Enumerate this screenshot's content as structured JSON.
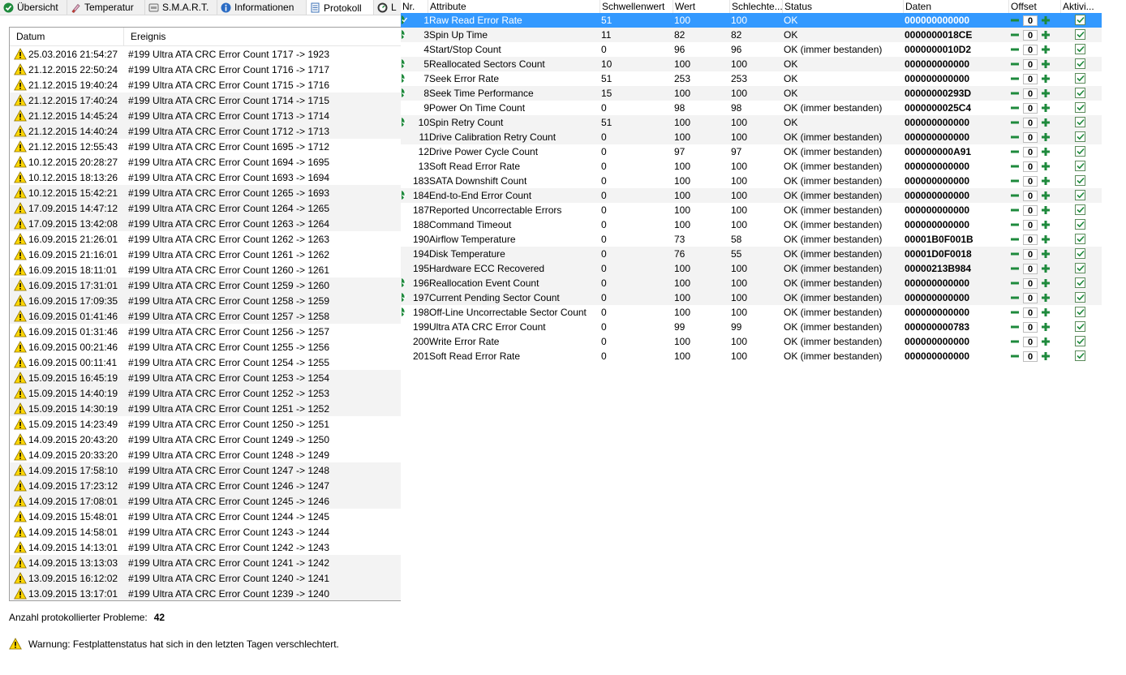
{
  "tabs": [
    {
      "label": "Übersicht",
      "icon": "green-check-icon"
    },
    {
      "label": "Temperatur",
      "icon": "thermometer-icon"
    },
    {
      "label": "S.M.A.R.T.",
      "icon": "smart-icon"
    },
    {
      "label": "Informationen",
      "icon": "info-icon"
    },
    {
      "label": "Protokoll",
      "icon": "document-icon",
      "active": true
    },
    {
      "label": "L",
      "icon": "gauge-icon"
    }
  ],
  "log": {
    "columns": {
      "date": "Datum",
      "event": "Ereignis"
    },
    "rows": [
      {
        "date": "25.03.2016 21:54:27",
        "event": "#199  Ultra ATA CRC Error Count  1717 -> 1923"
      },
      {
        "date": "21.12.2015 22:50:24",
        "event": "#199  Ultra ATA CRC Error Count  1716 -> 1717"
      },
      {
        "date": "21.12.2015 19:40:24",
        "event": "#199  Ultra ATA CRC Error Count  1715 -> 1716"
      },
      {
        "date": "21.12.2015 17:40:24",
        "event": "#199  Ultra ATA CRC Error Count  1714 -> 1715"
      },
      {
        "date": "21.12.2015 14:45:24",
        "event": "#199  Ultra ATA CRC Error Count  1713 -> 1714"
      },
      {
        "date": "21.12.2015 14:40:24",
        "event": "#199  Ultra ATA CRC Error Count  1712 -> 1713"
      },
      {
        "date": "21.12.2015 12:55:43",
        "event": "#199  Ultra ATA CRC Error Count  1695 -> 1712"
      },
      {
        "date": "10.12.2015 20:28:27",
        "event": "#199  Ultra ATA CRC Error Count  1694 -> 1695"
      },
      {
        "date": "10.12.2015 18:13:26",
        "event": "#199  Ultra ATA CRC Error Count  1693 -> 1694"
      },
      {
        "date": "10.12.2015 15:42:21",
        "event": "#199  Ultra ATA CRC Error Count  1265 -> 1693"
      },
      {
        "date": "17.09.2015 14:47:12",
        "event": "#199  Ultra ATA CRC Error Count  1264 -> 1265"
      },
      {
        "date": "17.09.2015 13:42:08",
        "event": "#199  Ultra ATA CRC Error Count  1263 -> 1264"
      },
      {
        "date": "16.09.2015 21:26:01",
        "event": "#199  Ultra ATA CRC Error Count  1262 -> 1263"
      },
      {
        "date": "16.09.2015 21:16:01",
        "event": "#199  Ultra ATA CRC Error Count  1261 -> 1262"
      },
      {
        "date": "16.09.2015 18:11:01",
        "event": "#199  Ultra ATA CRC Error Count  1260 -> 1261"
      },
      {
        "date": "16.09.2015 17:31:01",
        "event": "#199  Ultra ATA CRC Error Count  1259 -> 1260"
      },
      {
        "date": "16.09.2015 17:09:35",
        "event": "#199  Ultra ATA CRC Error Count  1258 -> 1259"
      },
      {
        "date": "16.09.2015 01:41:46",
        "event": "#199  Ultra ATA CRC Error Count  1257 -> 1258"
      },
      {
        "date": "16.09.2015 01:31:46",
        "event": "#199  Ultra ATA CRC Error Count  1256 -> 1257"
      },
      {
        "date": "16.09.2015 00:21:46",
        "event": "#199  Ultra ATA CRC Error Count  1255 -> 1256"
      },
      {
        "date": "16.09.2015 00:11:41",
        "event": "#199  Ultra ATA CRC Error Count  1254 -> 1255"
      },
      {
        "date": "15.09.2015 16:45:19",
        "event": "#199  Ultra ATA CRC Error Count  1253 -> 1254"
      },
      {
        "date": "15.09.2015 14:40:19",
        "event": "#199  Ultra ATA CRC Error Count  1252 -> 1253"
      },
      {
        "date": "15.09.2015 14:30:19",
        "event": "#199  Ultra ATA CRC Error Count  1251 -> 1252"
      },
      {
        "date": "15.09.2015 14:23:49",
        "event": "#199  Ultra ATA CRC Error Count  1250 -> 1251"
      },
      {
        "date": "14.09.2015 20:43:20",
        "event": "#199  Ultra ATA CRC Error Count  1249 -> 1250"
      },
      {
        "date": "14.09.2015 20:33:20",
        "event": "#199  Ultra ATA CRC Error Count  1248 -> 1249"
      },
      {
        "date": "14.09.2015 17:58:10",
        "event": "#199  Ultra ATA CRC Error Count  1247 -> 1248"
      },
      {
        "date": "14.09.2015 17:23:12",
        "event": "#199  Ultra ATA CRC Error Count  1246 -> 1247"
      },
      {
        "date": "14.09.2015 17:08:01",
        "event": "#199  Ultra ATA CRC Error Count  1245 -> 1246"
      },
      {
        "date": "14.09.2015 15:48:01",
        "event": "#199  Ultra ATA CRC Error Count  1244 -> 1245"
      },
      {
        "date": "14.09.2015 14:58:01",
        "event": "#199  Ultra ATA CRC Error Count  1243 -> 1244"
      },
      {
        "date": "14.09.2015 14:13:01",
        "event": "#199  Ultra ATA CRC Error Count  1242 -> 1243"
      },
      {
        "date": "14.09.2015 13:13:03",
        "event": "#199  Ultra ATA CRC Error Count  1241 -> 1242"
      },
      {
        "date": "13.09.2015 16:12:02",
        "event": "#199  Ultra ATA CRC Error Count  1240 -> 1241"
      },
      {
        "date": "13.09.2015 13:17:01",
        "event": "#199  Ultra ATA CRC Error Count  1239 -> 1240"
      }
    ]
  },
  "summary": {
    "label": "Anzahl protokollierter Probleme:",
    "value": "42"
  },
  "warning": {
    "text": "Warnung: Festplattenstatus hat sich in den letzten Tagen verschlechtert."
  },
  "smart": {
    "columns": {
      "nr": "Nr.",
      "attribute": "Attribute",
      "threshold": "Schwellenwert",
      "value": "Wert",
      "worst": "Schlechte...",
      "status": "Status",
      "data": "Daten",
      "offset": "Offset",
      "active": "Aktivi..."
    },
    "rows": [
      {
        "nr": "1",
        "attr": "Raw Read Error Rate",
        "thr": "51",
        "val": "100",
        "worst": "100",
        "status": "OK",
        "data": "000000000000",
        "offset": "0",
        "critical": true,
        "selected": true
      },
      {
        "nr": "3",
        "attr": "Spin Up Time",
        "thr": "11",
        "val": "82",
        "worst": "82",
        "status": "OK",
        "data": "0000000018CE",
        "offset": "0",
        "critical": true
      },
      {
        "nr": "4",
        "attr": "Start/Stop Count",
        "thr": "0",
        "val": "96",
        "worst": "96",
        "status": "OK (immer bestanden)",
        "data": "0000000010D2",
        "offset": "0",
        "critical": false
      },
      {
        "nr": "5",
        "attr": "Reallocated Sectors Count",
        "thr": "10",
        "val": "100",
        "worst": "100",
        "status": "OK",
        "data": "000000000000",
        "offset": "0",
        "critical": true
      },
      {
        "nr": "7",
        "attr": "Seek Error Rate",
        "thr": "51",
        "val": "253",
        "worst": "253",
        "status": "OK",
        "data": "000000000000",
        "offset": "0",
        "critical": true
      },
      {
        "nr": "8",
        "attr": "Seek Time Performance",
        "thr": "15",
        "val": "100",
        "worst": "100",
        "status": "OK",
        "data": "00000000293D",
        "offset": "0",
        "critical": true
      },
      {
        "nr": "9",
        "attr": "Power On Time Count",
        "thr": "0",
        "val": "98",
        "worst": "98",
        "status": "OK (immer bestanden)",
        "data": "0000000025C4",
        "offset": "0",
        "critical": false
      },
      {
        "nr": "10",
        "attr": "Spin Retry Count",
        "thr": "51",
        "val": "100",
        "worst": "100",
        "status": "OK",
        "data": "000000000000",
        "offset": "0",
        "critical": true
      },
      {
        "nr": "11",
        "attr": "Drive Calibration Retry Count",
        "thr": "0",
        "val": "100",
        "worst": "100",
        "status": "OK (immer bestanden)",
        "data": "000000000000",
        "offset": "0",
        "critical": false
      },
      {
        "nr": "12",
        "attr": "Drive Power Cycle Count",
        "thr": "0",
        "val": "97",
        "worst": "97",
        "status": "OK (immer bestanden)",
        "data": "000000000A91",
        "offset": "0",
        "critical": false
      },
      {
        "nr": "13",
        "attr": "Soft Read Error Rate",
        "thr": "0",
        "val": "100",
        "worst": "100",
        "status": "OK (immer bestanden)",
        "data": "000000000000",
        "offset": "0",
        "critical": false
      },
      {
        "nr": "183",
        "attr": "SATA Downshift Count",
        "thr": "0",
        "val": "100",
        "worst": "100",
        "status": "OK (immer bestanden)",
        "data": "000000000000",
        "offset": "0",
        "critical": false
      },
      {
        "nr": "184",
        "attr": "End-to-End Error Count",
        "thr": "0",
        "val": "100",
        "worst": "100",
        "status": "OK (immer bestanden)",
        "data": "000000000000",
        "offset": "0",
        "critical": true
      },
      {
        "nr": "187",
        "attr": "Reported Uncorrectable Errors",
        "thr": "0",
        "val": "100",
        "worst": "100",
        "status": "OK (immer bestanden)",
        "data": "000000000000",
        "offset": "0",
        "critical": false
      },
      {
        "nr": "188",
        "attr": "Command Timeout",
        "thr": "0",
        "val": "100",
        "worst": "100",
        "status": "OK (immer bestanden)",
        "data": "000000000000",
        "offset": "0",
        "critical": false
      },
      {
        "nr": "190",
        "attr": "Airflow Temperature",
        "thr": "0",
        "val": "73",
        "worst": "58",
        "status": "OK (immer bestanden)",
        "data": "00001B0F001B",
        "offset": "0",
        "critical": false
      },
      {
        "nr": "194",
        "attr": "Disk Temperature",
        "thr": "0",
        "val": "76",
        "worst": "55",
        "status": "OK (immer bestanden)",
        "data": "00001D0F0018",
        "offset": "0",
        "critical": false
      },
      {
        "nr": "195",
        "attr": "Hardware ECC Recovered",
        "thr": "0",
        "val": "100",
        "worst": "100",
        "status": "OK (immer bestanden)",
        "data": "00000213B984",
        "offset": "0",
        "critical": false
      },
      {
        "nr": "196",
        "attr": "Reallocation Event Count",
        "thr": "0",
        "val": "100",
        "worst": "100",
        "status": "OK (immer bestanden)",
        "data": "000000000000",
        "offset": "0",
        "critical": true
      },
      {
        "nr": "197",
        "attr": "Current Pending Sector Count",
        "thr": "0",
        "val": "100",
        "worst": "100",
        "status": "OK (immer bestanden)",
        "data": "000000000000",
        "offset": "0",
        "critical": true
      },
      {
        "nr": "198",
        "attr": "Off-Line Uncorrectable Sector Count",
        "thr": "0",
        "val": "100",
        "worst": "100",
        "status": "OK (immer bestanden)",
        "data": "000000000000",
        "offset": "0",
        "critical": true
      },
      {
        "nr": "199",
        "attr": "Ultra ATA CRC Error Count",
        "thr": "0",
        "val": "99",
        "worst": "99",
        "status": "OK (immer bestanden)",
        "data": "000000000783",
        "offset": "0",
        "critical": false
      },
      {
        "nr": "200",
        "attr": "Write Error Rate",
        "thr": "0",
        "val": "100",
        "worst": "100",
        "status": "OK (immer bestanden)",
        "data": "000000000000",
        "offset": "0",
        "critical": false
      },
      {
        "nr": "201",
        "attr": "Soft Read Error Rate",
        "thr": "0",
        "val": "100",
        "worst": "100",
        "status": "OK (immer bestanden)",
        "data": "000000000000",
        "offset": "0",
        "critical": false
      }
    ]
  },
  "colors": {
    "selection": "#3399ff",
    "accent_green": "#1e8a3c",
    "warning_yellow": "#ffd700"
  }
}
